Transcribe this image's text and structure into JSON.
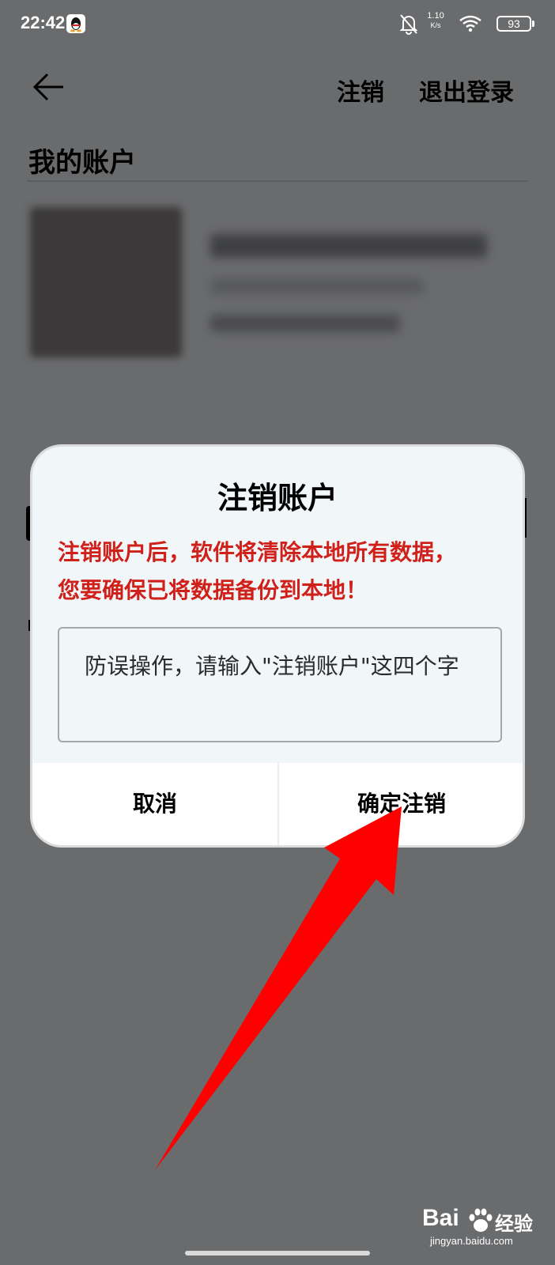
{
  "status_bar": {
    "time": "22:42",
    "net_speed_value": "1.10",
    "net_speed_unit": "K/s",
    "battery": "93"
  },
  "header": {
    "cancel_account_label": "注销",
    "logout_label": "退出登录"
  },
  "section": {
    "title": "我的账户"
  },
  "dialog": {
    "title": "注销账户",
    "warning": "注销账户后，软件将清除本地所有数据，您要确保已将数据备份到本地！",
    "input_placeholder": "防误操作，请输入\"注销账户\"这四个字",
    "cancel_label": "取消",
    "confirm_label": "确定注销"
  },
  "watermark": {
    "logo": "Bai",
    "text": "经验",
    "url": "jingyan.baidu.com"
  },
  "colors": {
    "overlay": "#6a6b6d",
    "dialog_bg": "#f1f6f9",
    "warning_red": "#d0201a",
    "arrow_red": "#ff0000"
  }
}
